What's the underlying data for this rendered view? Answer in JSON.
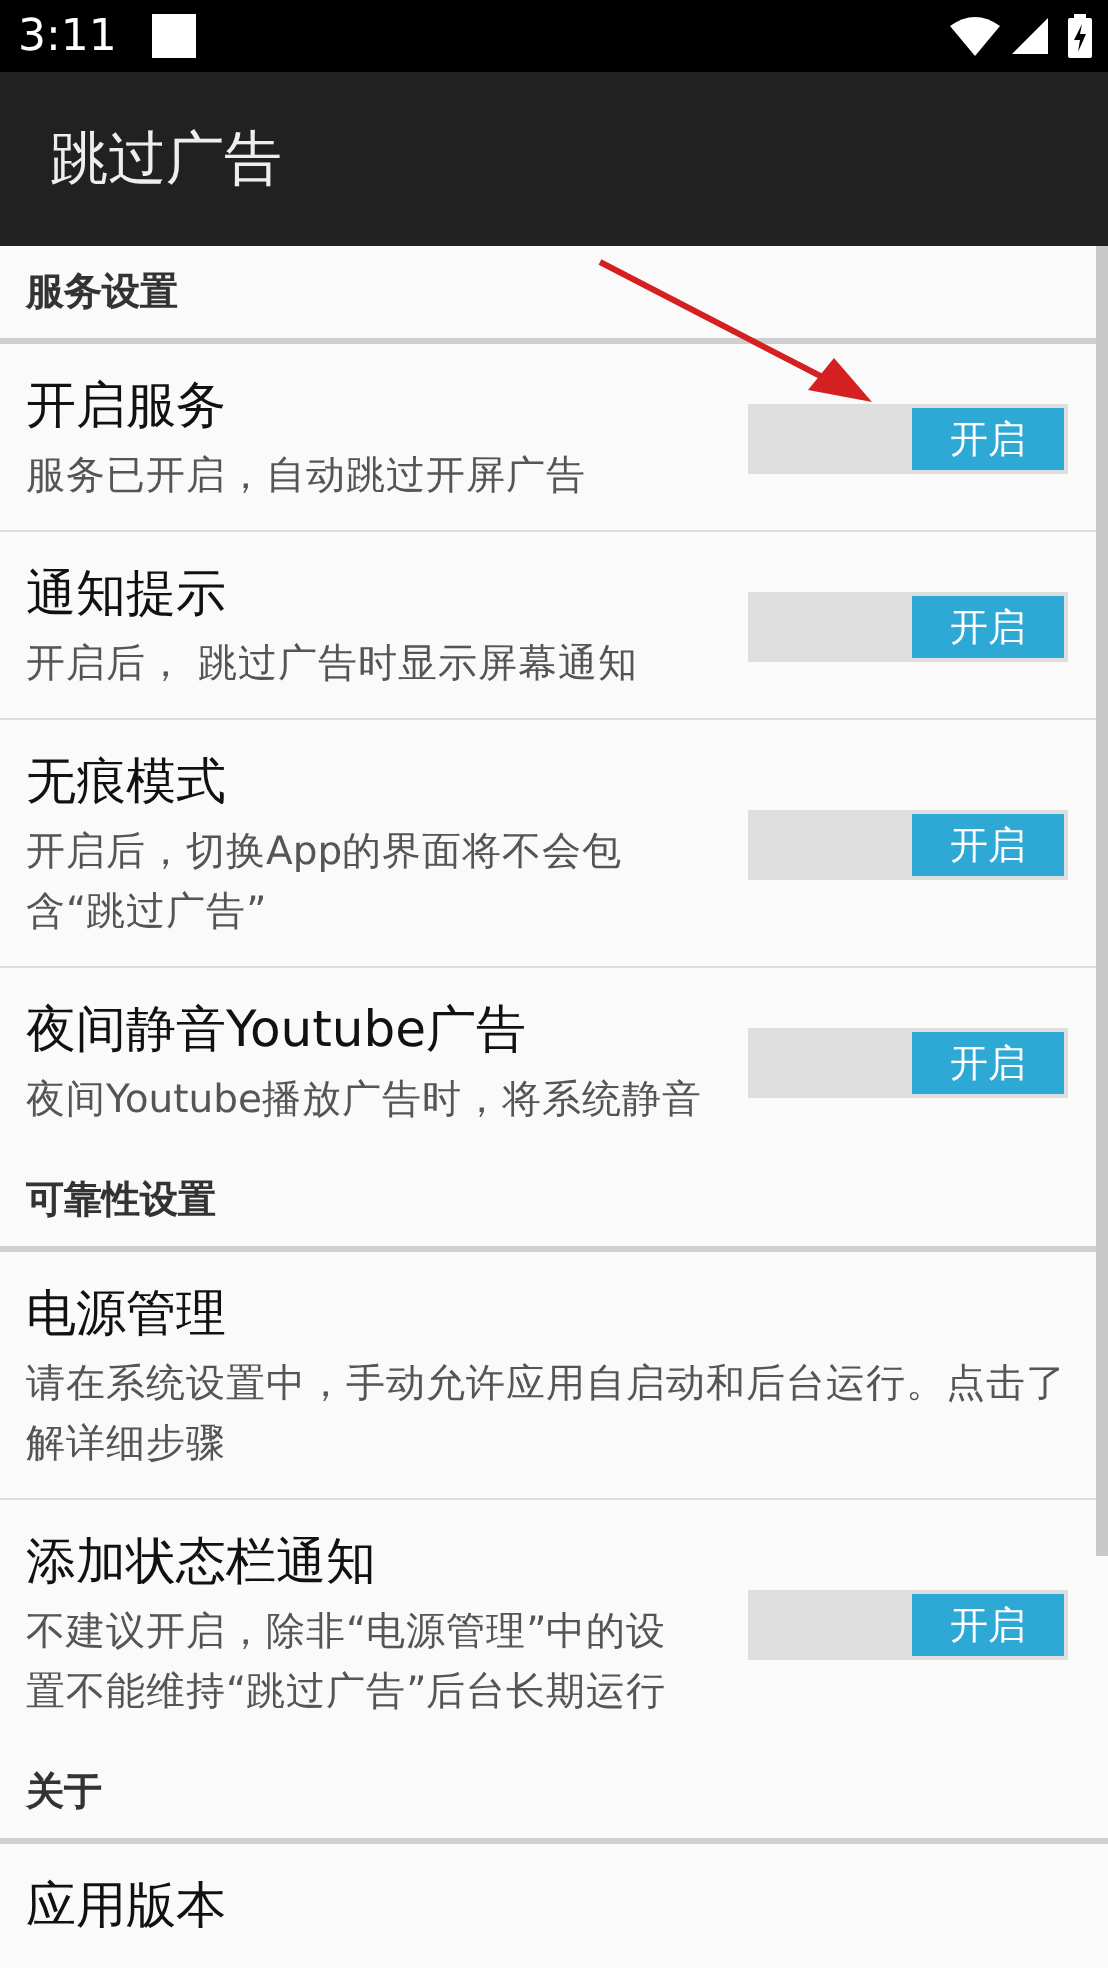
{
  "status_bar": {
    "time": "3:11"
  },
  "app_bar": {
    "title": "跳过广告"
  },
  "sections": [
    {
      "header": "服务设置",
      "items": [
        {
          "kind": "switch",
          "title": "开启服务",
          "summary": "服务已开启，自动跳过开屏广告",
          "on": true,
          "switch_label": "开启"
        },
        {
          "kind": "switch",
          "title": "通知提示",
          "summary": "开启后， 跳过广告时显示屏幕通知",
          "on": true,
          "switch_label": "开启"
        },
        {
          "kind": "switch",
          "title": "无痕模式",
          "summary": "开启后，切换App的界面将不会包含“跳过广告”",
          "on": true,
          "switch_label": "开启"
        },
        {
          "kind": "switch",
          "title": "夜间静音Youtube广告",
          "summary": "夜间Youtube播放广告时，将系统静音",
          "on": true,
          "switch_label": "开启"
        }
      ]
    },
    {
      "header": "可靠性设置",
      "items": [
        {
          "kind": "link",
          "title": "电源管理",
          "summary": "请在系统设置中，手动允许应用自启动和后台运行。点击了解详细步骤"
        },
        {
          "kind": "switch",
          "title": "添加状态栏通知",
          "summary": "不建议开启，除非“电源管理”中的设置不能维持“跳过广告”后台长期运行",
          "on": true,
          "switch_label": "开启"
        }
      ]
    },
    {
      "header": "关于",
      "items": [
        {
          "kind": "link",
          "title": "应用版本"
        }
      ]
    }
  ]
}
